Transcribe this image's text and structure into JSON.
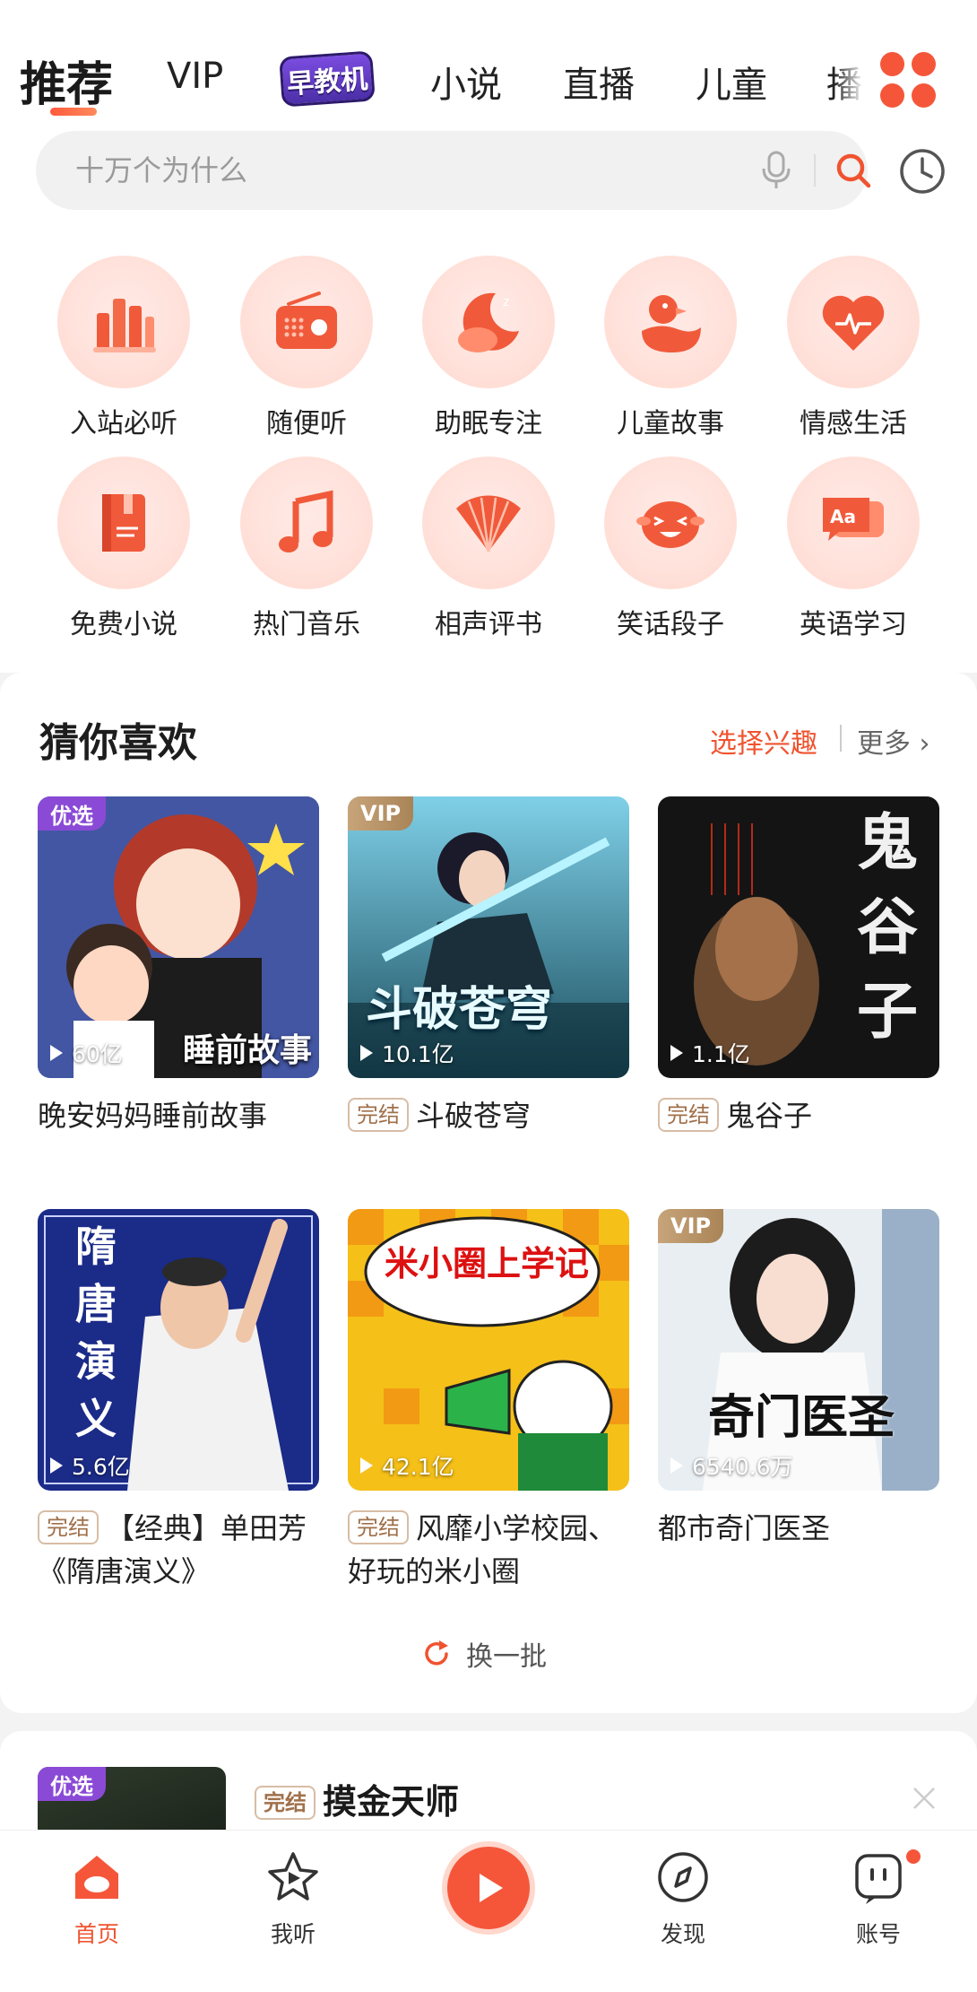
{
  "tabs": [
    "推荐",
    "VIP",
    "早教机",
    "小说",
    "直播",
    "儿童",
    "播"
  ],
  "search": {
    "placeholder": "十万个为什么"
  },
  "categories": [
    {
      "label": "入站必听",
      "icon": "chart-bars-icon"
    },
    {
      "label": "随便听",
      "icon": "radio-icon"
    },
    {
      "label": "助眠专注",
      "icon": "moon-cloud-icon"
    },
    {
      "label": "儿童故事",
      "icon": "duck-icon"
    },
    {
      "label": "情感生活",
      "icon": "heart-pulse-icon"
    },
    {
      "label": "免费小说",
      "icon": "book-icon"
    },
    {
      "label": "热门音乐",
      "icon": "music-note-icon"
    },
    {
      "label": "相声评书",
      "icon": "fan-icon"
    },
    {
      "label": "笑话段子",
      "icon": "laughing-face-icon"
    },
    {
      "label": "英语学习",
      "icon": "aa-chat-icon"
    }
  ],
  "guess": {
    "title": "猜你喜欢",
    "pick_interest": "选择兴趣",
    "more": "更多 ›",
    "refresh": "换一批",
    "done_tag": "完结",
    "cards": [
      {
        "badge": "优选",
        "plays": "60亿",
        "title": "晚安妈妈睡前故事",
        "cover_text": "睡前故事",
        "done": false
      },
      {
        "badge": "VIP",
        "plays": "10.1亿",
        "title": "斗破苍穹",
        "cover_text": "斗破苍穹",
        "done": true
      },
      {
        "badge": "",
        "plays": "1.1亿",
        "title": "鬼谷子",
        "cover_text": "鬼谷子",
        "done": true
      },
      {
        "badge": "",
        "plays": "5.6亿",
        "title": "【经典】单田芳《隋唐演义》",
        "cover_text": "隋唐演义",
        "done": true
      },
      {
        "badge": "",
        "plays": "42.1亿",
        "title": "风靡小学校园、好玩的米小圈",
        "cover_text": "米小圈上学记",
        "done": true
      },
      {
        "badge": "VIP",
        "plays": "6540.6万",
        "title": "都市奇门医圣",
        "cover_text": "奇门医圣",
        "done": false
      }
    ]
  },
  "next_item": {
    "badge": "优选",
    "done_tag": "完结",
    "title": "摸金天师"
  },
  "nav": [
    {
      "label": "首页",
      "icon": "home-icon"
    },
    {
      "label": "我听",
      "icon": "star-play-icon"
    },
    {
      "label": "发现",
      "icon": "compass-icon"
    },
    {
      "label": "账号",
      "icon": "account-face-icon"
    }
  ],
  "colors": {
    "accent": "#f5563a",
    "vip": "#b08d63",
    "pick": "#8a4ad6"
  }
}
